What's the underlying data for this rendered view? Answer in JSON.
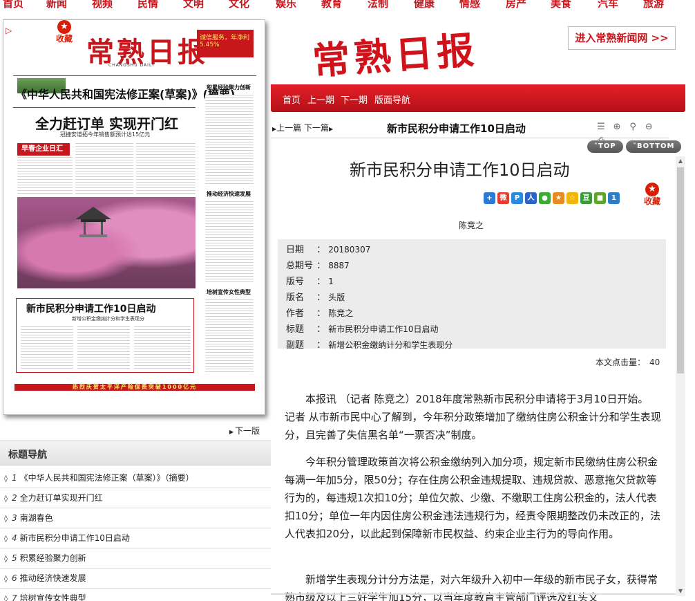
{
  "top_nav": [
    "首页",
    "新闻",
    "视频",
    "民情",
    "文明",
    "文化",
    "娱乐",
    "教育",
    "法制",
    "健康",
    "情感",
    "房产",
    "美食",
    "汽车",
    "旅游"
  ],
  "paper": {
    "fav_label": "收藏",
    "masthead": "常熟日报",
    "masthead_en": "CHANGSHU DAILY",
    "ad_right": "诚信服务，年净利 5.45%",
    "headline_1": "《中华人民共和国宪法修正案(草案)》(摘要)",
    "headline_2": "全力赶订单  实现开门红",
    "headline_2_sub": "冠捷安道拓今年销售额预计达15亿元",
    "section_label": "早春企业日汇",
    "right_titles": [
      "积累经验聚力创新",
      "推动经济快速发展",
      "培树宣传女性典型"
    ],
    "redbox_title": "新市民积分申请工作10日启动",
    "redbox_sub": "新增公积金缴纳计分和学生表现分",
    "bottom_banner": "热烈庆贺太平洋产险保费突破1000亿元"
  },
  "next_page": "下一版",
  "title_nav": {
    "heading": "标题导航",
    "items": [
      {
        "num": "1",
        "label": "《中华人民共和国宪法修正案（草案）》（摘要）"
      },
      {
        "num": "2",
        "label": "全力赶订单实现开门红"
      },
      {
        "num": "3",
        "label": "南湖春色"
      },
      {
        "num": "4",
        "label": "新市民积分申请工作10日启动"
      },
      {
        "num": "5",
        "label": "积累经验聚力创新"
      },
      {
        "num": "6",
        "label": "推动经济快速发展"
      },
      {
        "num": "7",
        "label": "培树宣传女性典型"
      }
    ]
  },
  "header": {
    "logo": "常熟日报",
    "enter_news": "进入常熟新闻网 >>"
  },
  "red_band": [
    "首页",
    "上一期",
    "下一期",
    "版面导航"
  ],
  "toolbar": {
    "prev": "上一篇",
    "next": "下一篇",
    "title": "新市民积分申请工作10日启动",
    "top_btn": "TOP",
    "bottom_btn": "BOTTOM"
  },
  "article": {
    "title": "新市民积分申请工作10日启动",
    "fav_label": "收藏",
    "author": "陈竞之",
    "meta": [
      {
        "k": "日期",
        "v": "20180307"
      },
      {
        "k": "总期号",
        "v": "8887"
      },
      {
        "k": "版号",
        "v": "1"
      },
      {
        "k": "版名",
        "v": "头版"
      },
      {
        "k": "作者",
        "v": "陈竞之"
      },
      {
        "k": "标题",
        "v": "新市民积分申请工作10日启动"
      },
      {
        "k": "副题",
        "v": "新增公积金缴纳计分和学生表现分"
      }
    ],
    "hits_label": "本文点击量：",
    "hits": "40",
    "paragraphs": [
      "本报讯 （记者 陈竞之）2018年度常熟新市民积分申请将于3月10日开始。 记者 从市新市民中心了解到，今年积分政策增加了缴纳住房公积金计分和学生表现分，且完善了失信黑名单“一票否决”制度。",
      "今年积分管理政策首次将公积金缴纳列入加分项，规定新市民缴纳住房公积金每满一年加5分，限50分；存在住房公积金违规提取、违规贷款、恶意拖欠贷款等行为的，每违规1次扣10分；单位欠款、少缴、不缴职工住房公积金的，法人代表扣10分；单位一年内因住房公积金违法违规行为，经责令限期整改仍未改正的，法人代表扣20分，以此起到保障新市民权益、约束企业主行为的导向作用。",
      "新增学生表现分计分方法是，对六年级升入初中一年级的新市民子女，获得常熟市级及以上三好学生加15分，以当年度教育主管部门评选及红头文"
    ]
  },
  "colors": {
    "brand_red": "#c8161d",
    "meta_bg": "#ececec"
  }
}
